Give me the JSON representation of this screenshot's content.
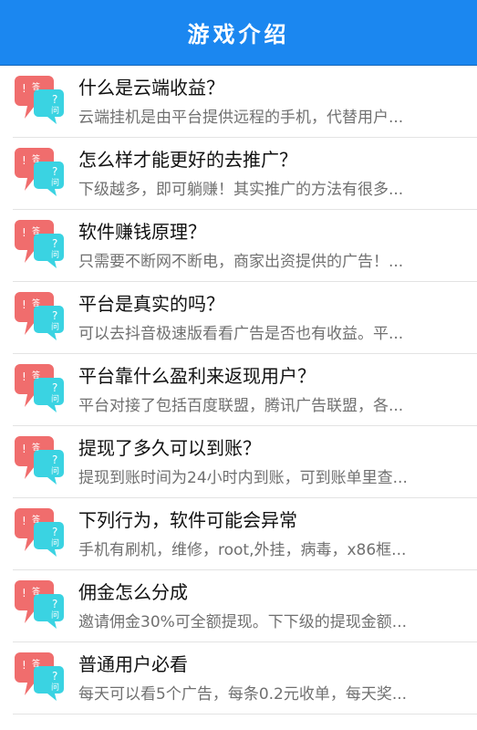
{
  "header": {
    "title": "游戏介绍"
  },
  "icons": {
    "qa_icon": "qa-bubble-icon",
    "red_bubble_color": "#f06d6d",
    "cyan_bubble_color": "#3ad3e2",
    "red_text": "答",
    "cyan_text": "问"
  },
  "items": [
    {
      "question": "什么是云端收益？",
      "answer": "云端挂机是由平台提供远程的手机，代替用户..."
    },
    {
      "question": "怎么样才能更好的去推广？",
      "answer": "下级越多，即可躺赚！其实推广的方法有很多..."
    },
    {
      "question": "软件赚钱原理？",
      "answer": "只需要不断网不断电，商家出资提供的广告！..."
    },
    {
      "question": "平台是真实的吗？",
      "answer": "可以去抖音极速版看看广告是否也有收益。平..."
    },
    {
      "question": "平台靠什么盈利来返现用户？",
      "answer": "平台对接了包括百度联盟，腾讯广告联盟，各..."
    },
    {
      "question": "提现了多久可以到账？",
      "answer": "提现到账时间为24小时内到账，可到账单里查..."
    },
    {
      "question": "下列行为，软件可能会异常",
      "answer": "手机有刷机，维修，root,外挂，病毒，x86框..."
    },
    {
      "question": "佣金怎么分成",
      "answer": "邀请佣金30%可全额提现。下下级的提现金额..."
    },
    {
      "question": "普通用户必看",
      "answer": "每天可以看5个广告，每条0.2元收单，每天奖..."
    }
  ]
}
